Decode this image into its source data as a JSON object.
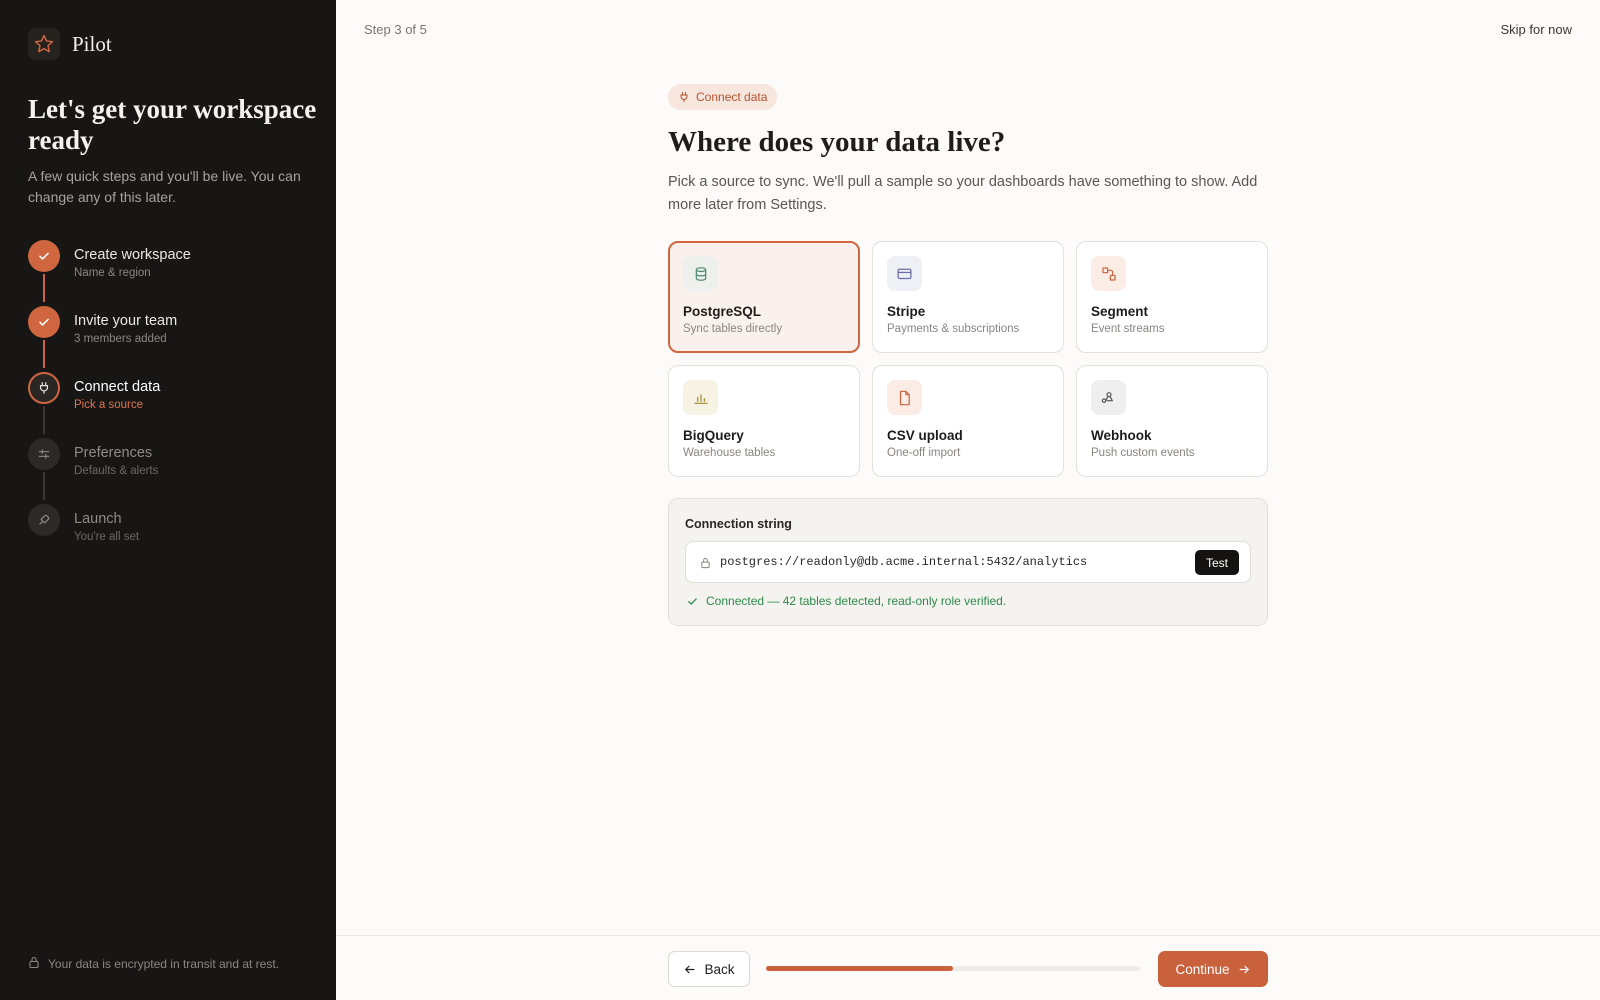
{
  "app": {
    "name": "Pilot",
    "logo_icon": "star-icon"
  },
  "sidebar": {
    "title": "Let's get your workspace ready",
    "subtitle": "A few quick steps and you'll be live. You can change any of this later.",
    "steps": [
      {
        "title": "Create workspace",
        "subtitle": "Name & region",
        "state": "done",
        "icon": "check-icon"
      },
      {
        "title": "Invite your team",
        "subtitle": "3 members added",
        "state": "done",
        "icon": "check-icon"
      },
      {
        "title": "Connect data",
        "subtitle": "Pick a source",
        "state": "current",
        "icon": "plug-icon"
      },
      {
        "title": "Preferences",
        "subtitle": "Defaults & alerts",
        "state": "todo",
        "icon": "sliders-icon"
      },
      {
        "title": "Launch",
        "subtitle": "You're all set",
        "state": "todo",
        "icon": "rocket-icon"
      }
    ],
    "footer_note": "Your data is encrypted in transit and at rest."
  },
  "header": {
    "step_indicator": "Step 3 of 5",
    "skip_label": "Skip for now"
  },
  "main": {
    "chip_label": "Connect data",
    "heading": "Where does your data live?",
    "description": "Pick a source to sync. We'll pull a sample so your dashboards have something to show. Add more later from Settings.",
    "sources": [
      {
        "name": "PostgreSQL",
        "subtitle": "Sync tables directly",
        "icon": "database-icon",
        "selected": true,
        "icon_bg": "#eef0ed",
        "icon_color": "#4c8a6c"
      },
      {
        "name": "Stripe",
        "subtitle": "Payments & subscriptions",
        "icon": "card-icon",
        "selected": false,
        "icon_bg": "#efeff6",
        "icon_color": "#6b6fa8"
      },
      {
        "name": "Segment",
        "subtitle": "Event streams",
        "icon": "segment-icon",
        "selected": false,
        "icon_bg": "#fbece6",
        "icon_color": "#c8613c"
      },
      {
        "name": "BigQuery",
        "subtitle": "Warehouse tables",
        "icon": "bar-chart-icon",
        "selected": false,
        "icon_bg": "#f6f2e4",
        "icon_color": "#a48a2c"
      },
      {
        "name": "CSV upload",
        "subtitle": "One-off import",
        "icon": "file-icon",
        "selected": false,
        "icon_bg": "#fbece6",
        "icon_color": "#c8613c"
      },
      {
        "name": "Webhook",
        "subtitle": "Push custom events",
        "icon": "webhook-icon",
        "selected": false,
        "icon_bg": "#efefef",
        "icon_color": "#555555"
      }
    ],
    "connection": {
      "label": "Connection string",
      "value": "postgres://readonly@db.acme.internal:5432/analytics",
      "test_label": "Test",
      "status": "Connected — 42 tables detected, read-only role verified."
    }
  },
  "footer": {
    "back_label": "Back",
    "continue_label": "Continue",
    "progress_fraction": 0.5
  },
  "colors": {
    "accent": "#c8613c",
    "success": "#2e8a4a",
    "sidebar_bg": "#171615"
  }
}
